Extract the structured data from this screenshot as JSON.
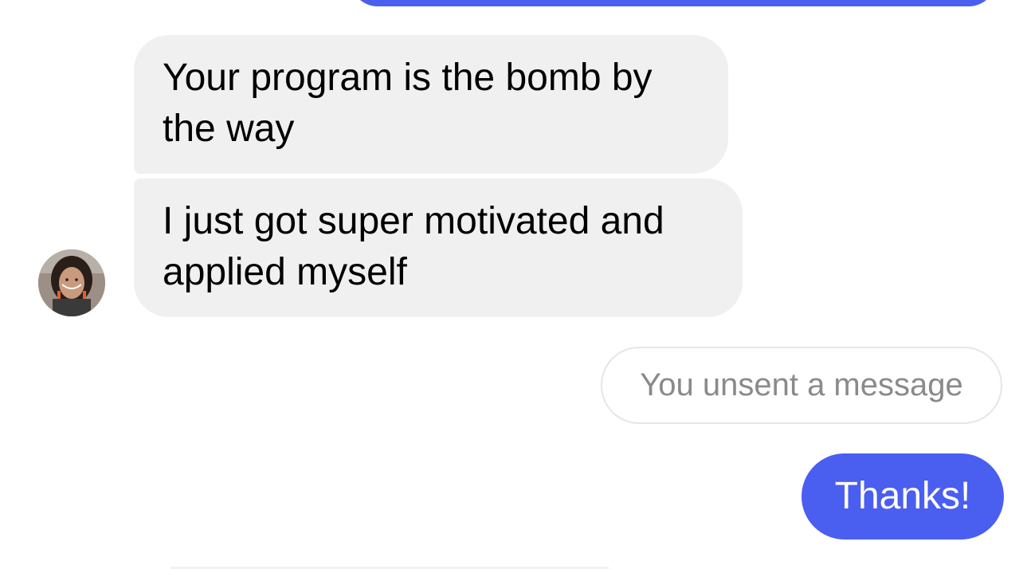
{
  "thread": {
    "messages": [
      {
        "sender": "them",
        "text": "Your program is the bomb by\nthe way"
      },
      {
        "sender": "them",
        "text": "I just got super motivated and\napplied myself"
      },
      {
        "sender": "me",
        "text": "You unsent a message",
        "kind": "unsent-notice"
      },
      {
        "sender": "me",
        "text": "Thanks!"
      }
    ]
  },
  "colors": {
    "outgoing_bubble": "#4a5ef0",
    "incoming_bubble": "#f0f0f0",
    "unsent_text": "#8a8a8a"
  },
  "icons": {
    "avatar": "contact-avatar-photo"
  }
}
